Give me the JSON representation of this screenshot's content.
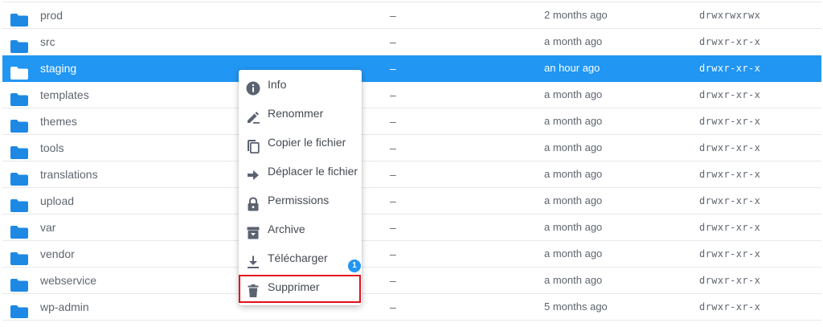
{
  "files": [
    {
      "name": "prod",
      "size": "–",
      "modified": "2 months ago",
      "permissions": "drwxrwxrwx",
      "selected": false
    },
    {
      "name": "src",
      "size": "–",
      "modified": "a month ago",
      "permissions": "drwxr-xr-x",
      "selected": false
    },
    {
      "name": "staging",
      "size": "–",
      "modified": "an hour ago",
      "permissions": "drwxr-xr-x",
      "selected": true
    },
    {
      "name": "templates",
      "size": "–",
      "modified": "a month ago",
      "permissions": "drwxr-xr-x",
      "selected": false
    },
    {
      "name": "themes",
      "size": "–",
      "modified": "a month ago",
      "permissions": "drwxr-xr-x",
      "selected": false
    },
    {
      "name": "tools",
      "size": "–",
      "modified": "a month ago",
      "permissions": "drwxr-xr-x",
      "selected": false
    },
    {
      "name": "translations",
      "size": "–",
      "modified": "a month ago",
      "permissions": "drwxr-xr-x",
      "selected": false
    },
    {
      "name": "upload",
      "size": "–",
      "modified": "a month ago",
      "permissions": "drwxr-xr-x",
      "selected": false
    },
    {
      "name": "var",
      "size": "–",
      "modified": "a month ago",
      "permissions": "drwxr-xr-x",
      "selected": false
    },
    {
      "name": "vendor",
      "size": "–",
      "modified": "a month ago",
      "permissions": "drwxr-xr-x",
      "selected": false
    },
    {
      "name": "webservice",
      "size": "–",
      "modified": "a month ago",
      "permissions": "drwxr-xr-x",
      "selected": false
    },
    {
      "name": "wp-admin",
      "size": "–",
      "modified": "5 months ago",
      "permissions": "drwxr-xr-x",
      "selected": false
    }
  ],
  "context_menu": {
    "items": [
      {
        "label": "Info",
        "icon": "info-icon"
      },
      {
        "label": "Renommer",
        "icon": "rename-icon"
      },
      {
        "label": "Copier le fichier",
        "icon": "copy-icon"
      },
      {
        "label": "Déplacer le fichier",
        "icon": "move-icon"
      },
      {
        "label": "Permissions",
        "icon": "lock-icon"
      },
      {
        "label": "Archive",
        "icon": "archive-icon"
      },
      {
        "label": "Télécharger",
        "icon": "download-icon"
      },
      {
        "label": "Supprimer",
        "icon": "trash-icon"
      }
    ]
  },
  "annotation": {
    "step_badge": "1",
    "highlighted_item": "Supprimer"
  },
  "colors": {
    "folder": "#1e88e5",
    "selected_row": "#2196f3",
    "highlight_border": "#e0101a",
    "badge": "#2196f3",
    "menu_icon": "#5b6270"
  }
}
